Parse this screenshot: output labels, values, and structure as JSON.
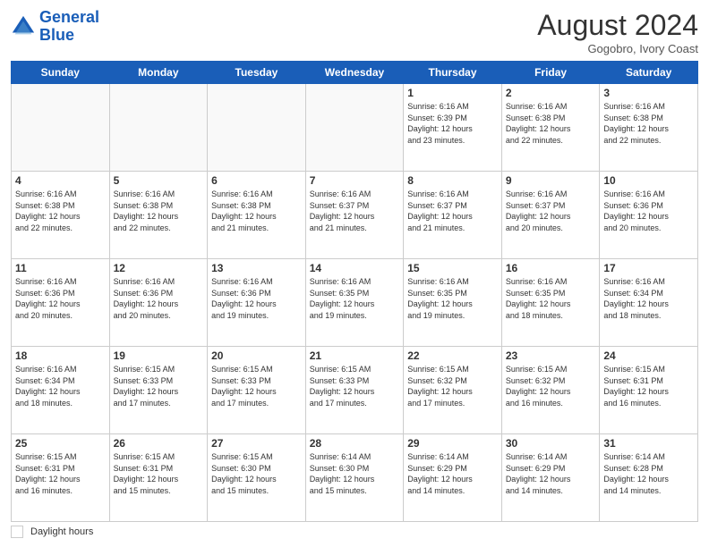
{
  "header": {
    "logo_line1": "General",
    "logo_line2": "Blue",
    "month_title": "August 2024",
    "subtitle": "Gogobro, Ivory Coast"
  },
  "days_of_week": [
    "Sunday",
    "Monday",
    "Tuesday",
    "Wednesday",
    "Thursday",
    "Friday",
    "Saturday"
  ],
  "weeks": [
    [
      {
        "day": "",
        "info": ""
      },
      {
        "day": "",
        "info": ""
      },
      {
        "day": "",
        "info": ""
      },
      {
        "day": "",
        "info": ""
      },
      {
        "day": "1",
        "info": "Sunrise: 6:16 AM\nSunset: 6:39 PM\nDaylight: 12 hours\nand 23 minutes."
      },
      {
        "day": "2",
        "info": "Sunrise: 6:16 AM\nSunset: 6:38 PM\nDaylight: 12 hours\nand 22 minutes."
      },
      {
        "day": "3",
        "info": "Sunrise: 6:16 AM\nSunset: 6:38 PM\nDaylight: 12 hours\nand 22 minutes."
      }
    ],
    [
      {
        "day": "4",
        "info": "Sunrise: 6:16 AM\nSunset: 6:38 PM\nDaylight: 12 hours\nand 22 minutes."
      },
      {
        "day": "5",
        "info": "Sunrise: 6:16 AM\nSunset: 6:38 PM\nDaylight: 12 hours\nand 22 minutes."
      },
      {
        "day": "6",
        "info": "Sunrise: 6:16 AM\nSunset: 6:38 PM\nDaylight: 12 hours\nand 21 minutes."
      },
      {
        "day": "7",
        "info": "Sunrise: 6:16 AM\nSunset: 6:37 PM\nDaylight: 12 hours\nand 21 minutes."
      },
      {
        "day": "8",
        "info": "Sunrise: 6:16 AM\nSunset: 6:37 PM\nDaylight: 12 hours\nand 21 minutes."
      },
      {
        "day": "9",
        "info": "Sunrise: 6:16 AM\nSunset: 6:37 PM\nDaylight: 12 hours\nand 20 minutes."
      },
      {
        "day": "10",
        "info": "Sunrise: 6:16 AM\nSunset: 6:36 PM\nDaylight: 12 hours\nand 20 minutes."
      }
    ],
    [
      {
        "day": "11",
        "info": "Sunrise: 6:16 AM\nSunset: 6:36 PM\nDaylight: 12 hours\nand 20 minutes."
      },
      {
        "day": "12",
        "info": "Sunrise: 6:16 AM\nSunset: 6:36 PM\nDaylight: 12 hours\nand 20 minutes."
      },
      {
        "day": "13",
        "info": "Sunrise: 6:16 AM\nSunset: 6:36 PM\nDaylight: 12 hours\nand 19 minutes."
      },
      {
        "day": "14",
        "info": "Sunrise: 6:16 AM\nSunset: 6:35 PM\nDaylight: 12 hours\nand 19 minutes."
      },
      {
        "day": "15",
        "info": "Sunrise: 6:16 AM\nSunset: 6:35 PM\nDaylight: 12 hours\nand 19 minutes."
      },
      {
        "day": "16",
        "info": "Sunrise: 6:16 AM\nSunset: 6:35 PM\nDaylight: 12 hours\nand 18 minutes."
      },
      {
        "day": "17",
        "info": "Sunrise: 6:16 AM\nSunset: 6:34 PM\nDaylight: 12 hours\nand 18 minutes."
      }
    ],
    [
      {
        "day": "18",
        "info": "Sunrise: 6:16 AM\nSunset: 6:34 PM\nDaylight: 12 hours\nand 18 minutes."
      },
      {
        "day": "19",
        "info": "Sunrise: 6:15 AM\nSunset: 6:33 PM\nDaylight: 12 hours\nand 17 minutes."
      },
      {
        "day": "20",
        "info": "Sunrise: 6:15 AM\nSunset: 6:33 PM\nDaylight: 12 hours\nand 17 minutes."
      },
      {
        "day": "21",
        "info": "Sunrise: 6:15 AM\nSunset: 6:33 PM\nDaylight: 12 hours\nand 17 minutes."
      },
      {
        "day": "22",
        "info": "Sunrise: 6:15 AM\nSunset: 6:32 PM\nDaylight: 12 hours\nand 17 minutes."
      },
      {
        "day": "23",
        "info": "Sunrise: 6:15 AM\nSunset: 6:32 PM\nDaylight: 12 hours\nand 16 minutes."
      },
      {
        "day": "24",
        "info": "Sunrise: 6:15 AM\nSunset: 6:31 PM\nDaylight: 12 hours\nand 16 minutes."
      }
    ],
    [
      {
        "day": "25",
        "info": "Sunrise: 6:15 AM\nSunset: 6:31 PM\nDaylight: 12 hours\nand 16 minutes."
      },
      {
        "day": "26",
        "info": "Sunrise: 6:15 AM\nSunset: 6:31 PM\nDaylight: 12 hours\nand 15 minutes."
      },
      {
        "day": "27",
        "info": "Sunrise: 6:15 AM\nSunset: 6:30 PM\nDaylight: 12 hours\nand 15 minutes."
      },
      {
        "day": "28",
        "info": "Sunrise: 6:14 AM\nSunset: 6:30 PM\nDaylight: 12 hours\nand 15 minutes."
      },
      {
        "day": "29",
        "info": "Sunrise: 6:14 AM\nSunset: 6:29 PM\nDaylight: 12 hours\nand 14 minutes."
      },
      {
        "day": "30",
        "info": "Sunrise: 6:14 AM\nSunset: 6:29 PM\nDaylight: 12 hours\nand 14 minutes."
      },
      {
        "day": "31",
        "info": "Sunrise: 6:14 AM\nSunset: 6:28 PM\nDaylight: 12 hours\nand 14 minutes."
      }
    ]
  ],
  "footer": {
    "label": "Daylight hours"
  }
}
